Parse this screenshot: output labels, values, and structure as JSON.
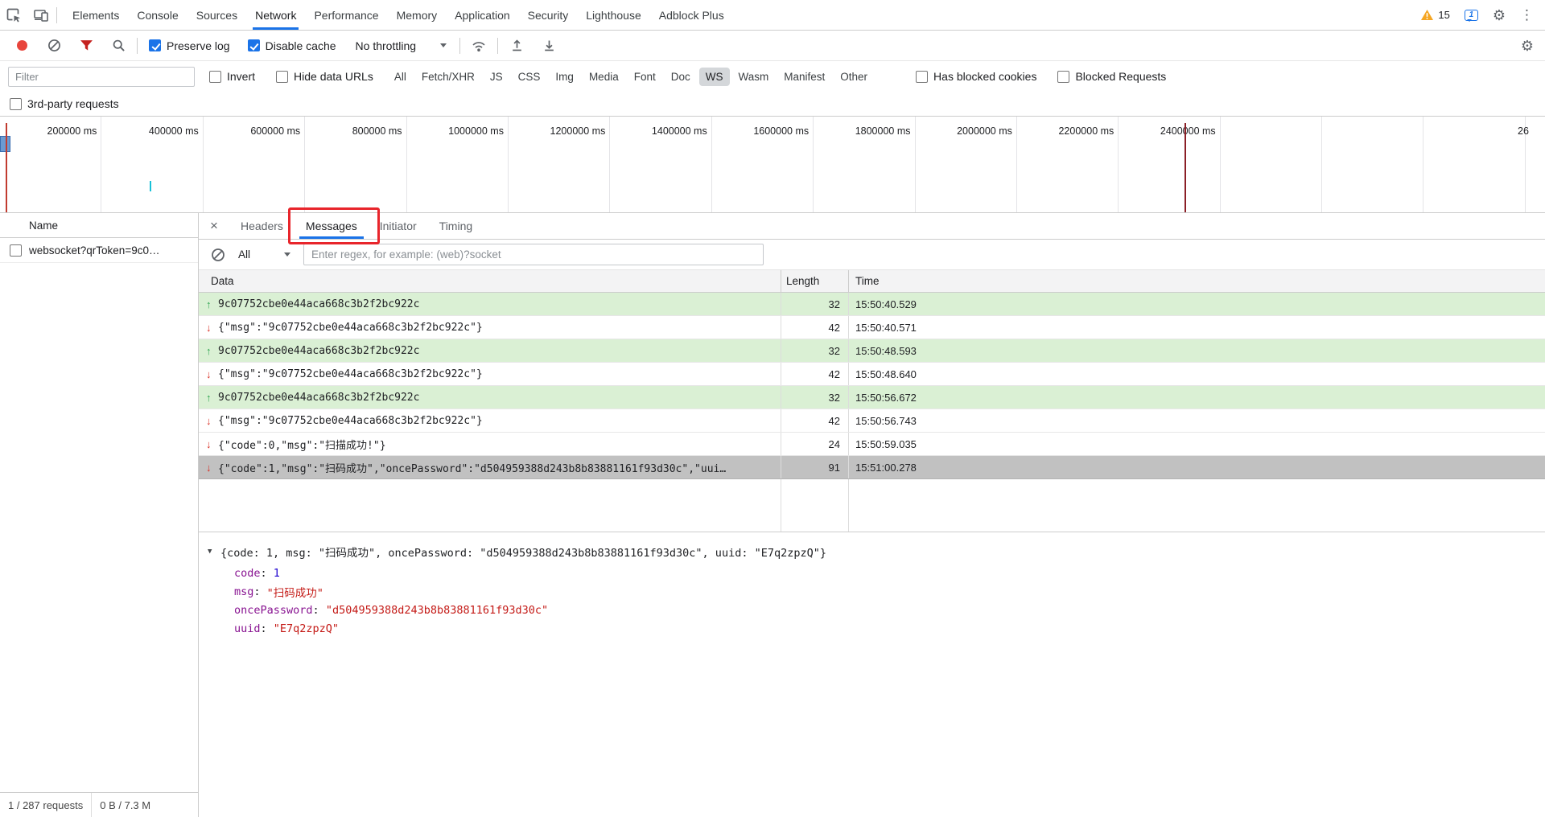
{
  "colors": {
    "accent_blue": "#1a73e8",
    "record_red": "#e8453c",
    "annotation_red": "#e8252b",
    "sent_row_green": "#daf0d4",
    "selected_row_gray": "#c1c1c1",
    "warning_yellow": "#f5a623",
    "arrow_sent_green": "#2da44e",
    "arrow_recv_red": "#d93025"
  },
  "top_bar": {
    "tabs": [
      "Elements",
      "Console",
      "Sources",
      "Network",
      "Performance",
      "Memory",
      "Application",
      "Security",
      "Lighthouse",
      "Adblock Plus"
    ],
    "active_tab": "Network",
    "warning_count": "15",
    "message_count": "1"
  },
  "toolbar": {
    "preserve_log": {
      "label": "Preserve log",
      "checked": true
    },
    "disable_cache": {
      "label": "Disable cache",
      "checked": true
    },
    "throttling_value": "No throttling"
  },
  "filters": {
    "filter_placeholder": "Filter",
    "invert": {
      "label": "Invert",
      "checked": false
    },
    "hide_data_urls": {
      "label": "Hide data URLs",
      "checked": false
    },
    "types": [
      "All",
      "Fetch/XHR",
      "JS",
      "CSS",
      "Img",
      "Media",
      "Font",
      "Doc",
      "WS",
      "Wasm",
      "Manifest",
      "Other"
    ],
    "active_type": "WS",
    "has_blocked_cookies": {
      "label": "Has blocked cookies",
      "checked": false
    },
    "blocked_requests": {
      "label": "Blocked Requests",
      "checked": false
    },
    "third_party": {
      "label": "3rd-party requests",
      "checked": false
    }
  },
  "timeline": {
    "labels": [
      "200000 ms",
      "400000 ms",
      "600000 ms",
      "800000 ms",
      "1000000 ms",
      "1200000 ms",
      "1400000 ms",
      "1600000 ms",
      "1800000 ms",
      "2000000 ms",
      "2200000 ms",
      "2400000 ms"
    ],
    "clipped_label": "26"
  },
  "requests_panel": {
    "name_header": "Name",
    "requests": [
      {
        "name": "websocket?qrToken=9c0…",
        "checked": false
      }
    ],
    "status_requests": "1 / 287 requests",
    "status_transferred": "0 B / 7.3 M"
  },
  "details": {
    "tabs": [
      "Headers",
      "Messages",
      "Initiator",
      "Timing"
    ],
    "active_tab": "Messages",
    "filter_all_value": "All",
    "regex_placeholder": "Enter regex, for example: (web)?socket",
    "columns": [
      "Data",
      "Length",
      "Time"
    ],
    "messages": [
      {
        "direction": "sent",
        "data": "9c07752cbe0e44aca668c3b2f2bc922c",
        "length": "32",
        "time": "15:50:40.529",
        "selected": false
      },
      {
        "direction": "received",
        "data": "{\"msg\":\"9c07752cbe0e44aca668c3b2f2bc922c\"}",
        "length": "42",
        "time": "15:50:40.571",
        "selected": false
      },
      {
        "direction": "sent",
        "data": "9c07752cbe0e44aca668c3b2f2bc922c",
        "length": "32",
        "time": "15:50:48.593",
        "selected": false
      },
      {
        "direction": "received",
        "data": "{\"msg\":\"9c07752cbe0e44aca668c3b2f2bc922c\"}",
        "length": "42",
        "time": "15:50:48.640",
        "selected": false
      },
      {
        "direction": "sent",
        "data": "9c07752cbe0e44aca668c3b2f2bc922c",
        "length": "32",
        "time": "15:50:56.672",
        "selected": false
      },
      {
        "direction": "received",
        "data": "{\"msg\":\"9c07752cbe0e44aca668c3b2f2bc922c\"}",
        "length": "42",
        "time": "15:50:56.743",
        "selected": false
      },
      {
        "direction": "received",
        "data": "{\"code\":0,\"msg\":\"扫描成功!\"}",
        "length": "24",
        "time": "15:50:59.035",
        "selected": false
      },
      {
        "direction": "received",
        "data": "{\"code\":1,\"msg\":\"扫码成功\",\"oncePassword\":\"d504959388d243b8b83881161f93d30c\",\"uui…",
        "length": "91",
        "time": "15:51:00.278",
        "selected": true
      }
    ],
    "tree": {
      "preview": "{code: 1, msg: \"扫码成功\", oncePassword: \"d504959388d243b8b83881161f93d30c\", uuid: \"E7q2zpzQ\"}",
      "entries": [
        {
          "key": "code",
          "value": "1",
          "type": "number"
        },
        {
          "key": "msg",
          "value": "\"扫码成功\"",
          "type": "string"
        },
        {
          "key": "oncePassword",
          "value": "\"d504959388d243b8b83881161f93d30c\"",
          "type": "string"
        },
        {
          "key": "uuid",
          "value": "\"E7q2zpzQ\"",
          "type": "string"
        }
      ]
    }
  }
}
